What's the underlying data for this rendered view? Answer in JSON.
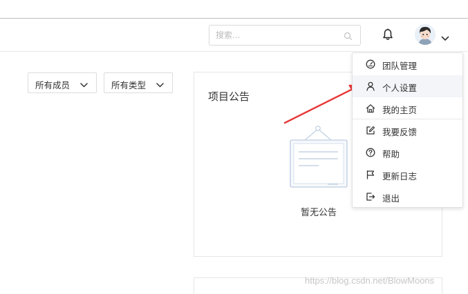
{
  "header": {
    "search": {
      "placeholder": "搜索..."
    }
  },
  "filters": {
    "members": "所有成员",
    "types": "所有类型"
  },
  "notice": {
    "title": "项目公告",
    "empty_text": "暂无公告"
  },
  "user_menu": {
    "items": [
      {
        "label": "团队管理",
        "icon": "dashboard-icon"
      },
      {
        "label": "个人设置",
        "icon": "user-icon"
      },
      {
        "label": "我的主页",
        "icon": "home-icon"
      },
      {
        "label": "我要反馈",
        "icon": "edit-icon"
      },
      {
        "label": "帮助",
        "icon": "help-icon"
      },
      {
        "label": "更新日志",
        "icon": "flag-icon"
      },
      {
        "label": "退出",
        "icon": "logout-icon"
      }
    ],
    "active_item": "个人设置"
  },
  "watermark": "https://blog.csdn.net/BlowMoons",
  "colors": {
    "arrow": "#e8393a",
    "border": "#e6e6e6",
    "menu_hover_bg": "#f3f5f8",
    "illustration": "#c5d3e4"
  }
}
